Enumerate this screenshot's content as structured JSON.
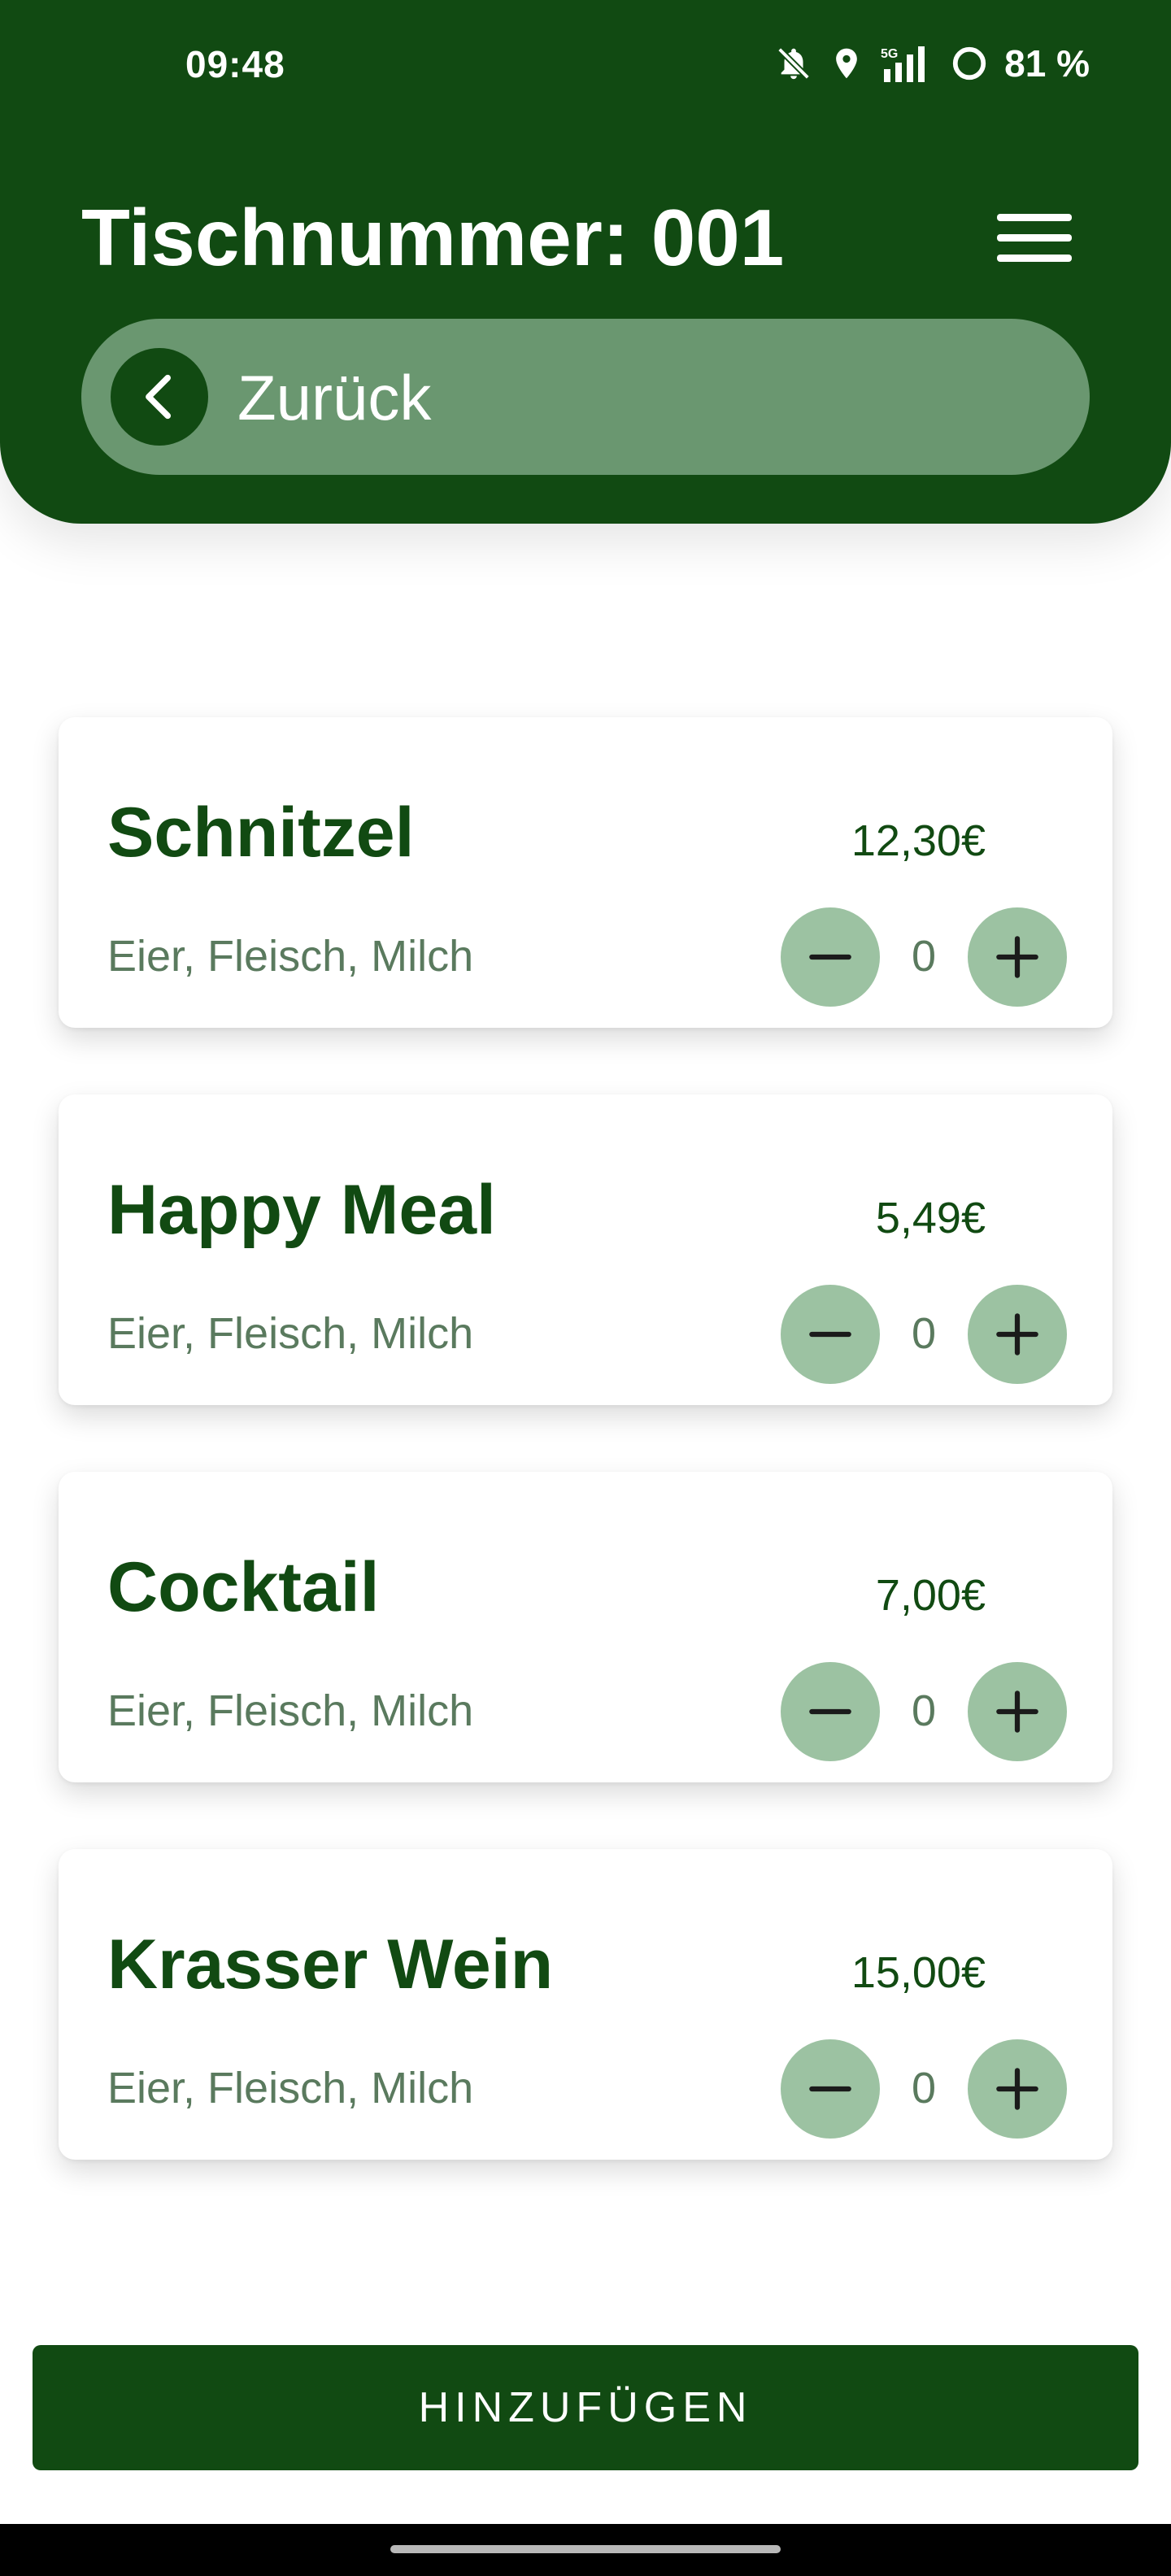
{
  "status_bar": {
    "time": "09:48",
    "network": "5G",
    "battery": "81 %",
    "icons": [
      "bell-muted-icon",
      "location-pin-icon",
      "signal-5g-icon",
      "battery-ring-icon"
    ]
  },
  "header": {
    "title": "Tischnummer: 001",
    "menu_icon": "hamburger-menu-icon",
    "back_label": "Zurück",
    "back_icon": "chevron-left-icon"
  },
  "items": [
    {
      "name": "Schnitzel",
      "price": "12,30€",
      "allergens": "Eier, Fleisch, Milch",
      "quantity": "0"
    },
    {
      "name": "Happy Meal",
      "price": "5,49€",
      "allergens": "Eier, Fleisch, Milch",
      "quantity": "0"
    },
    {
      "name": "Cocktail",
      "price": "7,00€",
      "allergens": "Eier, Fleisch, Milch",
      "quantity": "0"
    },
    {
      "name": "Krasser Wein",
      "price": "15,00€",
      "allergens": "Eier, Fleisch, Milch",
      "quantity": "0"
    }
  ],
  "actions": {
    "submit_label": "HINZUFÜGEN"
  },
  "colors": {
    "primary": "#114a12",
    "back_bar": "#6a9770",
    "qty_button": "#9cc2a2",
    "muted_text": "#5a7a5e"
  }
}
